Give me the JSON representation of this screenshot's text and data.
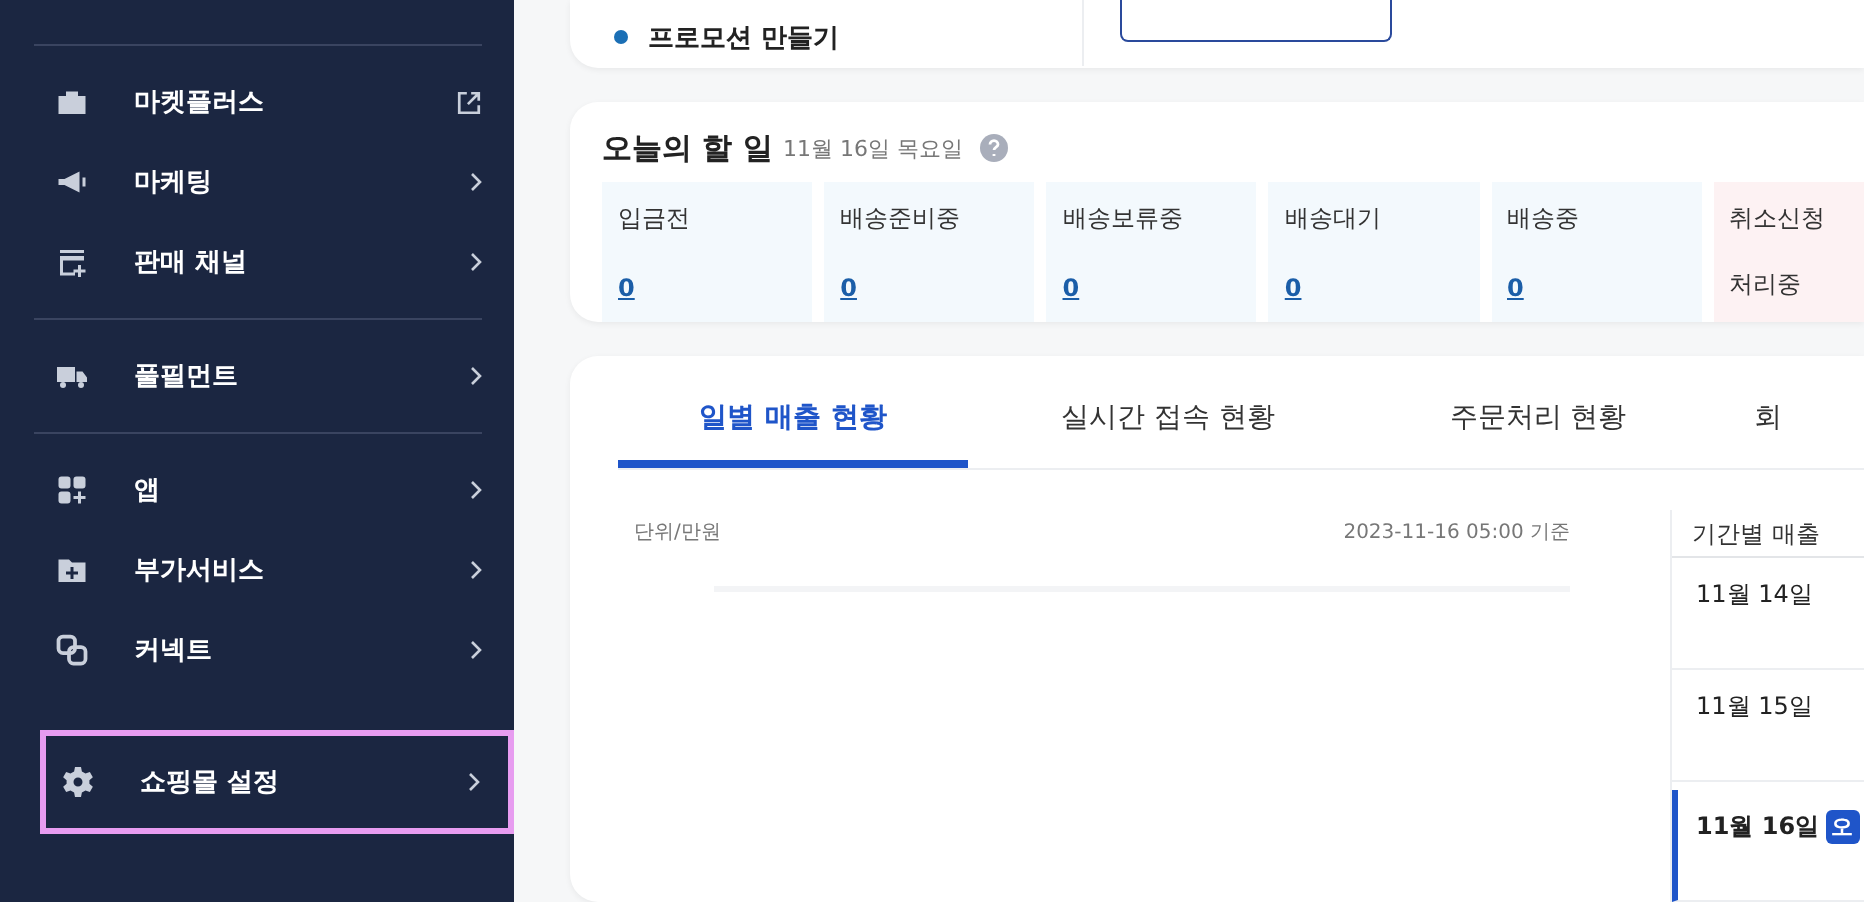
{
  "sidebar": {
    "groups": [
      {
        "items": [
          {
            "label": "마켓플러스",
            "kind": "external",
            "selected": false
          },
          {
            "label": "마케팅",
            "kind": "chevron",
            "selected": false
          },
          {
            "label": "판매 채널",
            "kind": "chevron",
            "selected": false
          }
        ]
      },
      {
        "items": [
          {
            "label": "풀필먼트",
            "kind": "chevron",
            "selected": false
          }
        ]
      },
      {
        "items": [
          {
            "label": "앱",
            "kind": "chevron",
            "selected": false
          },
          {
            "label": "부가서비스",
            "kind": "chevron",
            "selected": false
          },
          {
            "label": "커넥트",
            "kind": "chevron",
            "selected": false
          }
        ]
      },
      {
        "items": [
          {
            "label": "쇼핑몰 설정",
            "kind": "chevron",
            "selected": true
          }
        ]
      }
    ]
  },
  "promo": {
    "label": "프로모션 만들기"
  },
  "todo": {
    "title": "오늘의 할 일",
    "date": "11월 16일 목요일",
    "tiles": [
      {
        "label": "입금전",
        "value": "0",
        "alert": false
      },
      {
        "label": "배송준비중",
        "value": "0",
        "alert": false
      },
      {
        "label": "배송보류중",
        "value": "0",
        "alert": false
      },
      {
        "label": "배송대기",
        "value": "0",
        "alert": false
      },
      {
        "label": "배송중",
        "value": "0",
        "alert": false
      },
      {
        "label": "취소신청",
        "value": "처리중",
        "alert": true
      }
    ]
  },
  "sales": {
    "tabs": [
      {
        "label": "일별 매출 현황",
        "selected": true
      },
      {
        "label": "실시간 접속 현황",
        "selected": false
      },
      {
        "label": "주문처리 현황",
        "selected": false
      },
      {
        "label": "회",
        "selected": false
      }
    ],
    "unit": "단위/만원",
    "timestamp": "2023-11-16 05:00 기준",
    "period": {
      "header": "기간별 매출",
      "rows": [
        {
          "date": "11월 14일",
          "selected": false
        },
        {
          "date": "11월 15일",
          "selected": false
        },
        {
          "date": "11월 16일",
          "selected": true,
          "badge": "오"
        }
      ]
    }
  }
}
